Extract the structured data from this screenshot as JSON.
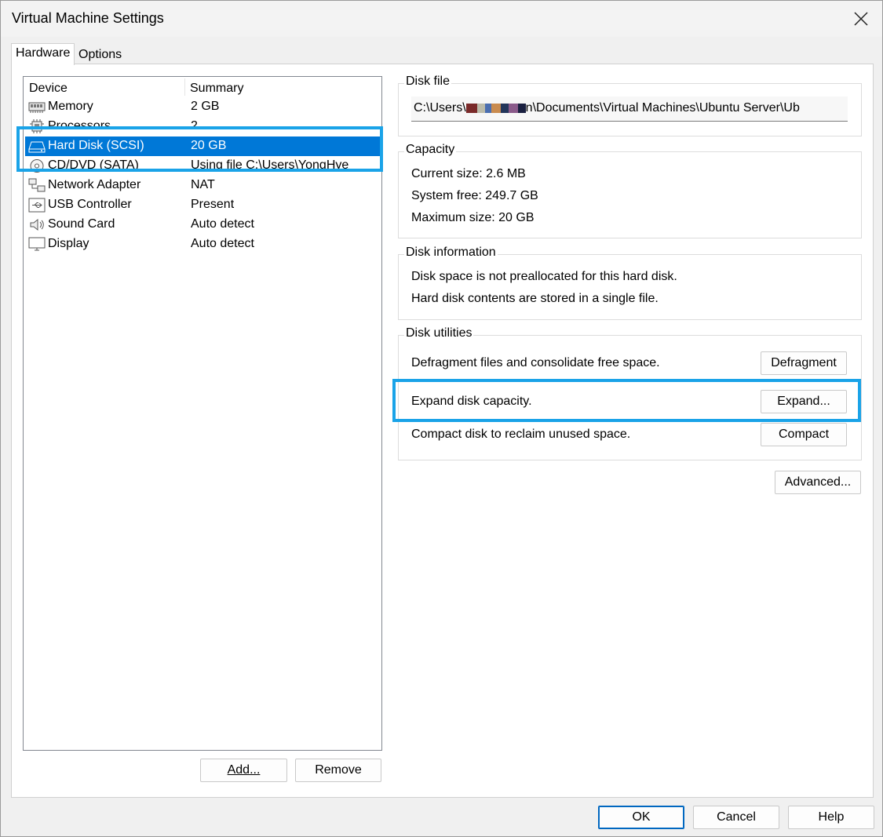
{
  "window": {
    "title": "Virtual Machine Settings"
  },
  "tabs": [
    {
      "label": "Hardware",
      "active": true
    },
    {
      "label": "Options",
      "active": false
    }
  ],
  "device_list": {
    "columns": [
      "Device",
      "Summary"
    ],
    "rows": [
      {
        "icon": "memory-icon",
        "name": "Memory",
        "summary": "2 GB"
      },
      {
        "icon": "processor-icon",
        "name": "Processors",
        "summary": "2"
      },
      {
        "icon": "hard-disk-icon",
        "name": "Hard Disk (SCSI)",
        "summary": "20 GB",
        "selected": true
      },
      {
        "icon": "cd-dvd-icon",
        "name": "CD/DVD (SATA)",
        "summary": "Using file C:\\Users\\YongHye"
      },
      {
        "icon": "network-adapter-icon",
        "name": "Network Adapter",
        "summary": "NAT"
      },
      {
        "icon": "usb-icon",
        "name": "USB Controller",
        "summary": "Present"
      },
      {
        "icon": "sound-card-icon",
        "name": "Sound Card",
        "summary": "Auto detect"
      },
      {
        "icon": "display-icon",
        "name": "Display",
        "summary": "Auto detect"
      }
    ],
    "add_label": "Add...",
    "remove_label": "Remove"
  },
  "disk_file": {
    "label": "Disk file",
    "path_prefix": "C:\\Users\\",
    "path_suffix": "n\\Documents\\Virtual Machines\\Ubuntu Server\\Ub"
  },
  "capacity": {
    "label": "Capacity",
    "current_size": "Current size:  2.6 MB",
    "system_free": "System free:  249.7 GB",
    "maximum_size": "Maximum size:  20 GB"
  },
  "disk_information": {
    "label": "Disk information",
    "line1": "Disk space is not preallocated for this hard disk.",
    "line2": "Hard disk contents are stored in a single file."
  },
  "disk_utilities": {
    "label": "Disk utilities",
    "defragment_text": "Defragment files and consolidate free space.",
    "defragment_button": "Defragment",
    "expand_text": "Expand disk capacity.",
    "expand_button": "Expand...",
    "compact_text": "Compact disk to reclaim unused space.",
    "compact_button": "Compact"
  },
  "advanced_button": "Advanced...",
  "footer": {
    "ok": "OK",
    "cancel": "Cancel",
    "help": "Help"
  },
  "colors": {
    "selection": "#0078d7",
    "highlight_annotation": "#1aa3e8"
  }
}
